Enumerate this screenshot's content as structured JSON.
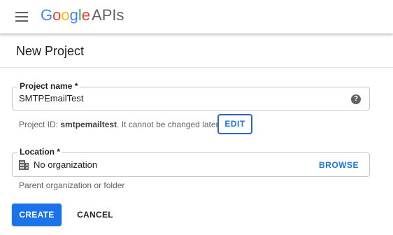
{
  "header": {
    "logo_google_letters": [
      "G",
      "o",
      "o",
      "g",
      "l",
      "e"
    ],
    "logo_google_colors": [
      "#4285f4",
      "#ea4335",
      "#fbbc05",
      "#4285f4",
      "#34a853",
      "#ea4335"
    ],
    "logo_product": "APIs",
    "menu_icon": "hamburger-menu-icon"
  },
  "page": {
    "title": "New Project"
  },
  "form": {
    "project_name": {
      "label": "Project name *",
      "value": "SMTPEmailTest",
      "help_icon": "help-circle-icon",
      "help_glyph": "?"
    },
    "project_id": {
      "prefix": "Project ID: ",
      "id": "smtpemailtest",
      "suffix": ". It cannot be changed later.",
      "edit_label": "EDIT"
    },
    "location": {
      "label": "Location *",
      "value": "No organization",
      "icon": "building-icon",
      "browse_label": "BROWSE",
      "hint": "Parent organization or folder"
    }
  },
  "actions": {
    "create_label": "CREATE",
    "cancel_label": "CANCEL"
  },
  "colors": {
    "accent": "#1a73e8",
    "focus_border": "#2f62c9"
  }
}
